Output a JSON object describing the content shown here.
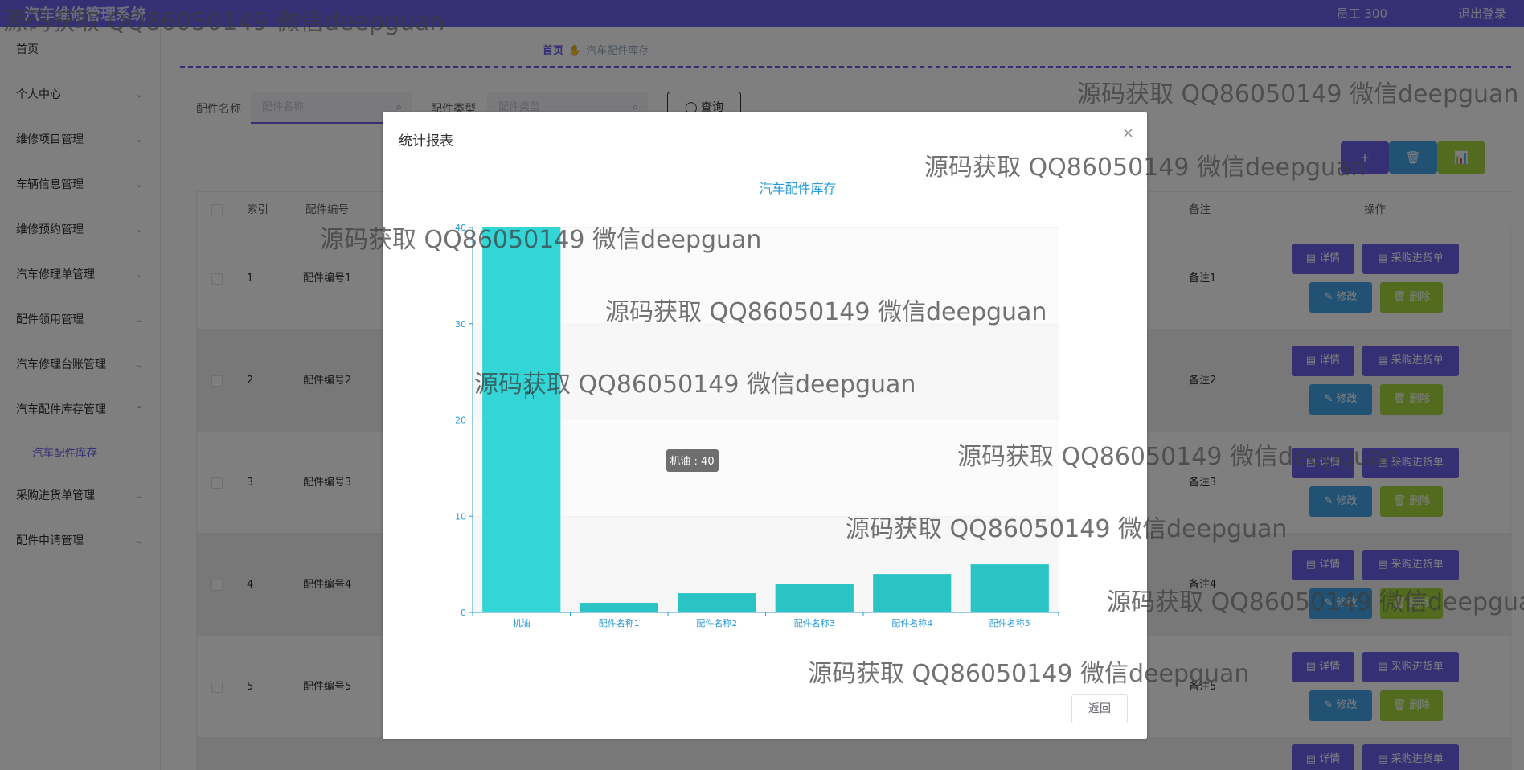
{
  "header": {
    "app_title": "汽车维修管理系统",
    "user": "员工 300",
    "logout": "退出登录"
  },
  "sidebar": {
    "items": [
      {
        "label": "首页",
        "arrow": ""
      },
      {
        "label": "个人中心",
        "arrow": "⌄"
      },
      {
        "label": "维修项目管理",
        "arrow": "⌄"
      },
      {
        "label": "车辆信息管理",
        "arrow": "⌄"
      },
      {
        "label": "维修预约管理",
        "arrow": "⌄"
      },
      {
        "label": "汽车修理单管理",
        "arrow": "⌄"
      },
      {
        "label": "配件领用管理",
        "arrow": "⌄"
      },
      {
        "label": "汽车修理台账管理",
        "arrow": "⌄"
      },
      {
        "label": "汽车配件库存管理",
        "arrow": "⌃"
      },
      {
        "label": "汽车配件库存",
        "arrow": ""
      },
      {
        "label": "采购进货单管理",
        "arrow": "⌄"
      },
      {
        "label": "配件申请管理",
        "arrow": "⌄"
      }
    ]
  },
  "breadcrumb": {
    "home": "首页",
    "sep_icon": "✋",
    "current": "汽车配件库存"
  },
  "search": {
    "name_label": "配件名称",
    "name_placeholder": "配件名称",
    "type_label": "配件类型",
    "type_placeholder": "配件类型",
    "query_button": "◯ 查询",
    "search_icon": "⌕"
  },
  "toolbar": {
    "add": "+",
    "delete": "🗑",
    "chart": "📊"
  },
  "table": {
    "headers": {
      "index": "索引",
      "code": "配件编号",
      "note": "备注",
      "ops": "操作"
    },
    "rows": [
      {
        "index": "1",
        "code": "配件编号1",
        "note": "备注1"
      },
      {
        "index": "2",
        "code": "配件编号2",
        "note": "备注2"
      },
      {
        "index": "3",
        "code": "配件编号3",
        "note": "备注3"
      },
      {
        "index": "4",
        "code": "配件编号4",
        "note": "备注4"
      },
      {
        "index": "5",
        "code": "配件编号5",
        "note": "备注5"
      }
    ],
    "ops": {
      "detail": "▤ 详情",
      "purchase": "▤ 采购进货单",
      "edit": "✎ 修改",
      "delete": "🗑 删除"
    }
  },
  "dialog": {
    "title": "统计报表",
    "close": "×",
    "back": "返回",
    "tooltip": "机油 : 40"
  },
  "chart_data": {
    "type": "bar",
    "title": "汽车配件库存",
    "categories": [
      "机油",
      "配件名称1",
      "配件名称2",
      "配件名称3",
      "配件名称4",
      "配件名称5"
    ],
    "values": [
      40,
      1,
      2,
      3,
      4,
      5
    ],
    "ylim": [
      0,
      40
    ],
    "yticks": [
      0,
      10,
      20,
      30,
      40
    ],
    "xlabel": "",
    "ylabel": "",
    "grid": "horizontal-bands",
    "colors": {
      "bar": "#33d5d6",
      "bar_hover": "#2bc4c5",
      "axis": "#2a9bd8",
      "title": "#2a9bd8"
    }
  },
  "watermark": {
    "text": "源码获取 QQ86050149 微信deepguan"
  },
  "colors": {
    "primary": "#6a5ee8",
    "edit": "#42a5e8",
    "delete": "#a5d63f"
  }
}
